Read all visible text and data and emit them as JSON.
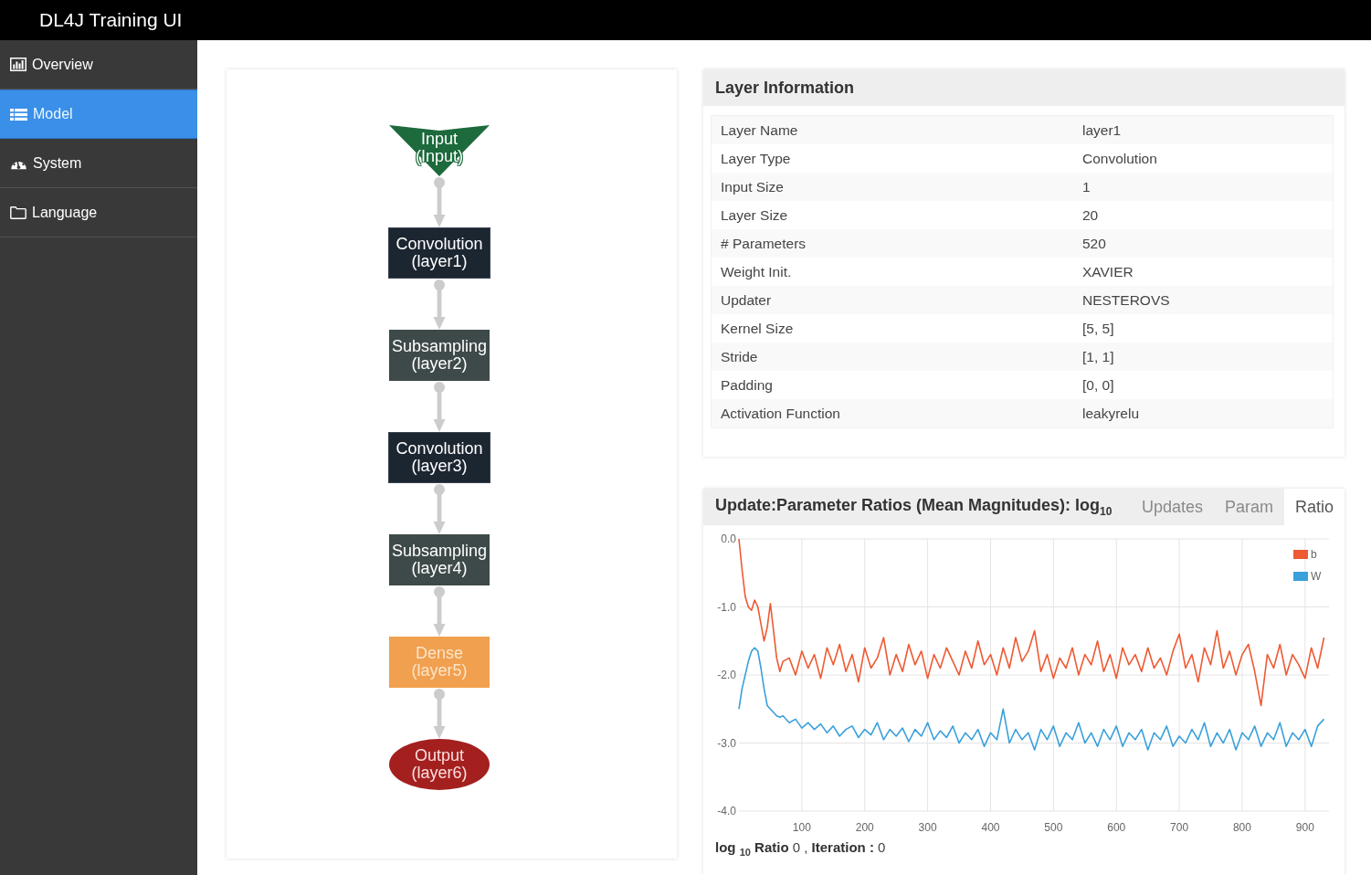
{
  "header": {
    "title": "DL4J Training UI"
  },
  "sidebar": {
    "items": [
      {
        "label": "Overview",
        "selected": false
      },
      {
        "label": "Model",
        "selected": true
      },
      {
        "label": "System",
        "selected": false
      },
      {
        "label": "Language",
        "selected": false
      }
    ]
  },
  "model_graph": {
    "nodes": [
      {
        "kind": "input",
        "label": "Input",
        "sublabel": "(Input)"
      },
      {
        "kind": "convolution",
        "label": "Convolution",
        "sublabel": "(layer1)"
      },
      {
        "kind": "subsampling",
        "label": "Subsampling",
        "sublabel": "(layer2)"
      },
      {
        "kind": "convolution",
        "label": "Convolution",
        "sublabel": "(layer3)"
      },
      {
        "kind": "subsampling",
        "label": "Subsampling",
        "sublabel": "(layer4)"
      },
      {
        "kind": "dense",
        "label": "Dense",
        "sublabel": "(layer5)"
      },
      {
        "kind": "output",
        "label": "Output",
        "sublabel": "(layer6)"
      }
    ]
  },
  "layer_information": {
    "title": "Layer Information",
    "rows": [
      {
        "label": "Layer Name",
        "value": "layer1"
      },
      {
        "label": "Layer Type",
        "value": "Convolution"
      },
      {
        "label": "Input Size",
        "value": "1"
      },
      {
        "label": "Layer Size",
        "value": "20"
      },
      {
        "label": "# Parameters",
        "value": "520"
      },
      {
        "label": "Weight Init.",
        "value": "XAVIER"
      },
      {
        "label": "Updater",
        "value": "NESTEROVS"
      },
      {
        "label": "Kernel Size",
        "value": "[5, 5]"
      },
      {
        "label": "Stride",
        "value": "[1, 1]"
      },
      {
        "label": "Padding",
        "value": "[0, 0]"
      },
      {
        "label": "Activation Function",
        "value": "leakyrelu"
      }
    ]
  },
  "ratio_chart": {
    "title": "Update:Parameter Ratios (Mean Magnitudes): log$_{10}$",
    "tabs": [
      {
        "label": "Updates",
        "selected": false
      },
      {
        "label": "Param",
        "selected": false
      },
      {
        "label": "Ratio",
        "selected": true
      }
    ],
    "chart_data": {
      "type": "line",
      "x": [
        0,
        5,
        10,
        15,
        20,
        25,
        30,
        35,
        40,
        45,
        50,
        55,
        60,
        65,
        70,
        80,
        90,
        100,
        110,
        120,
        130,
        140,
        150,
        160,
        170,
        180,
        190,
        200,
        210,
        220,
        230,
        240,
        250,
        260,
        270,
        280,
        290,
        300,
        310,
        320,
        330,
        340,
        350,
        360,
        370,
        380,
        390,
        400,
        410,
        420,
        430,
        440,
        450,
        460,
        470,
        480,
        490,
        500,
        510,
        520,
        530,
        540,
        550,
        560,
        570,
        580,
        590,
        600,
        610,
        620,
        630,
        640,
        650,
        660,
        670,
        680,
        690,
        700,
        710,
        720,
        730,
        740,
        750,
        760,
        770,
        780,
        790,
        800,
        810,
        820,
        830,
        840,
        850,
        860,
        870,
        880,
        890,
        900,
        910,
        920,
        930
      ],
      "series": [
        {
          "name": "b",
          "color": "#ee5a33",
          "values": [
            0.0,
            -0.45,
            -0.85,
            -1.0,
            -1.05,
            -0.9,
            -1.0,
            -1.25,
            -1.5,
            -1.3,
            -0.95,
            -1.35,
            -1.75,
            -1.95,
            -1.8,
            -1.75,
            -2.0,
            -1.65,
            -1.9,
            -1.7,
            -2.05,
            -1.6,
            -1.85,
            -1.55,
            -1.95,
            -1.7,
            -2.1,
            -1.6,
            -1.9,
            -1.75,
            -1.45,
            -2.0,
            -1.7,
            -1.95,
            -1.55,
            -1.85,
            -1.65,
            -2.05,
            -1.7,
            -1.9,
            -1.6,
            -1.8,
            -2.0,
            -1.65,
            -1.9,
            -1.5,
            -1.85,
            -1.7,
            -2.0,
            -1.6,
            -1.9,
            -1.45,
            -1.8,
            -1.65,
            -1.35,
            -1.95,
            -1.7,
            -2.05,
            -1.75,
            -1.9,
            -1.6,
            -2.0,
            -1.7,
            -1.85,
            -1.5,
            -1.95,
            -1.7,
            -2.05,
            -1.6,
            -1.85,
            -1.7,
            -1.95,
            -1.6,
            -1.9,
            -1.75,
            -2.0,
            -1.65,
            -1.4,
            -1.9,
            -1.7,
            -2.1,
            -1.6,
            -1.85,
            -1.35,
            -1.9,
            -1.65,
            -2.0,
            -1.7,
            -1.55,
            -1.95,
            -2.45,
            -1.7,
            -1.9,
            -1.55,
            -2.0,
            -1.7,
            -1.85,
            -2.05,
            -1.6,
            -1.9,
            -1.45
          ]
        },
        {
          "name": "W",
          "color": "#3aa0db",
          "values": [
            -2.5,
            -2.2,
            -2.0,
            -1.8,
            -1.65,
            -1.6,
            -1.65,
            -1.9,
            -2.2,
            -2.45,
            -2.5,
            -2.55,
            -2.6,
            -2.62,
            -2.6,
            -2.7,
            -2.65,
            -2.78,
            -2.7,
            -2.8,
            -2.72,
            -2.85,
            -2.75,
            -2.9,
            -2.8,
            -2.75,
            -2.92,
            -2.8,
            -2.88,
            -2.7,
            -2.95,
            -2.8,
            -2.9,
            -2.78,
            -2.98,
            -2.8,
            -2.9,
            -2.7,
            -2.95,
            -2.82,
            -2.92,
            -2.75,
            -3.0,
            -2.85,
            -2.95,
            -2.8,
            -3.05,
            -2.85,
            -2.95,
            -2.5,
            -3.0,
            -2.8,
            -2.95,
            -2.85,
            -3.1,
            -2.8,
            -2.95,
            -2.75,
            -3.05,
            -2.85,
            -2.95,
            -2.7,
            -3.0,
            -2.85,
            -3.05,
            -2.8,
            -2.95,
            -2.75,
            -3.05,
            -2.85,
            -2.95,
            -2.8,
            -3.1,
            -2.85,
            -2.95,
            -2.75,
            -3.05,
            -2.9,
            -3.0,
            -2.8,
            -2.95,
            -2.7,
            -3.05,
            -2.85,
            -3.0,
            -2.8,
            -3.1,
            -2.85,
            -2.95,
            -2.75,
            -3.05,
            -2.85,
            -2.95,
            -2.7,
            -3.05,
            -2.85,
            -2.95,
            -2.8,
            -3.05,
            -2.75,
            -2.65
          ]
        }
      ],
      "xlim": [
        0,
        938
      ],
      "ylim": [
        -4,
        0
      ],
      "xticks": [
        100,
        200,
        300,
        400,
        500,
        600,
        700,
        800,
        900
      ],
      "yticks": [
        {
          "value": 0,
          "label": "0.0"
        },
        {
          "value": -1,
          "label": "-1.0"
        },
        {
          "value": -2,
          "label": "-2.0"
        },
        {
          "value": -3,
          "label": "-3.0"
        },
        {
          "value": -4,
          "label": "-4.0"
        }
      ],
      "grid": true,
      "legend": true
    },
    "readout": "**log** $_{10}$ **Ratio** 0 , **Iteration :** 0"
  }
}
